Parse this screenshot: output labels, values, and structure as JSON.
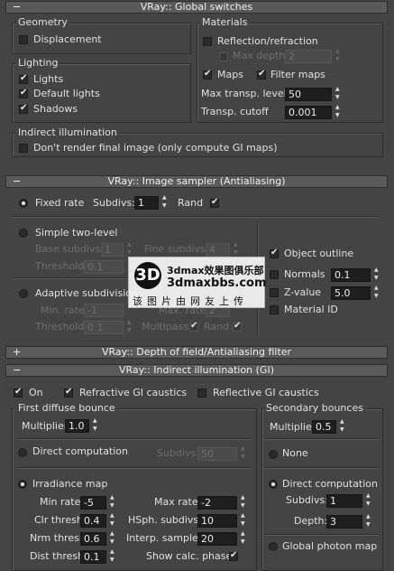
{
  "global": {
    "title": "VRay:: Global switches",
    "geometry": {
      "title": "Geometry",
      "displacement": "Displacement"
    },
    "materials": {
      "title": "Materials",
      "reflection": "Reflection/refraction",
      "max_depth": "Max depth",
      "max_depth_value": "2",
      "maps": "Maps",
      "filter_maps": "Filter maps",
      "max_transp": "Max transp. levels",
      "max_transp_value": "50",
      "transp_cutoff": "Transp. cutoff",
      "transp_cutoff_value": "0.001"
    },
    "lighting": {
      "title": "Lighting",
      "lights": "Lights",
      "default_lights": "Default lights",
      "shadows": "Shadows"
    },
    "indirect": {
      "title": "Indirect illumination",
      "dont_render": "Don't render final image (only compute GI maps)"
    }
  },
  "sampler": {
    "title": "VRay:: Image sampler (Antialiasing)",
    "fixed_rate": "Fixed rate",
    "subdivs": "Subdivs:",
    "subdivs_value": "1",
    "rand": "Rand",
    "simple": "Simple two-level",
    "base_subdivs": "Base subdivs:",
    "base_value": "1",
    "fine_subdivs": "Fine subdivs:",
    "fine_value": "4",
    "threshold": "Threshold:",
    "threshold_value": "0.1",
    "object_outline": "Object outline",
    "normals": "Normals",
    "normals_value": "0.1",
    "zvalue": "Z-value",
    "zvalue_value": "5.0",
    "material_id": "Material ID",
    "adaptive": "Adaptive subdivision",
    "min_rate": "Min. rate:",
    "min_rate_value": "-1",
    "max_rate": "Max. rate:",
    "max_rate_value": "2",
    "threshold2_value": "0.1",
    "multipass": "Multipass",
    "rand2": "Rand"
  },
  "dof": {
    "title": "VRay:: Depth of field/Antialiasing filter"
  },
  "gi": {
    "title": "VRay:: Indirect illumination (GI)",
    "on": "On",
    "refractive": "Refractive GI caustics",
    "reflective": "Reflective GI caustics",
    "first": {
      "title": "First diffuse bounce",
      "multiplier": "Multiplier:",
      "multiplier_value": "1.0",
      "direct": "Direct computation",
      "subdivs": "Subdivs:",
      "subdivs_value": "50",
      "irradiance": "Irradiance map",
      "min_rate": "Min rate:",
      "min_rate_value": "-5",
      "max_rate": "Max rate:",
      "max_rate_value": "-2",
      "clr_thresh": "Clr thresh:",
      "clr_value": "0.4",
      "hsph": "HSph. subdivs:",
      "hsph_value": "10",
      "nrm_thresh": "Nrm thresh:",
      "nrm_value": "0.6",
      "interp": "Interp. samples:",
      "interp_value": "20",
      "dist_thresh": "Dist thresh:",
      "dist_value": "0.1",
      "show_calc": "Show calc. phase"
    },
    "second": {
      "title": "Secondary bounces",
      "multiplier": "Multiplier:",
      "multiplier_value": "0.5",
      "none": "None",
      "direct": "Direct computation",
      "subdivs": "Subdivs:",
      "subdivs_value": "1",
      "depth": "Depth:",
      "depth_value": "3",
      "photon": "Global photon map"
    }
  },
  "watermark": {
    "logo": "3D",
    "line1": "3dmax效果图俱乐部",
    "line2": "3dmaxbbs.com",
    "line3": "该图片由网友上传"
  }
}
